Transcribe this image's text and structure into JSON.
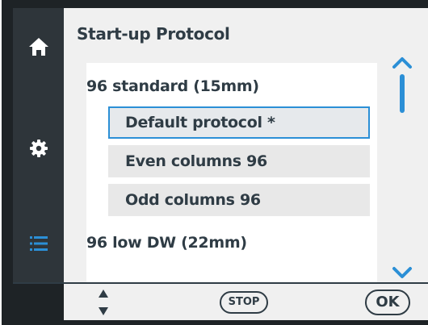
{
  "screen": {
    "title": "Start-up Protocol"
  },
  "nav": {
    "items": [
      {
        "icon": "home-icon"
      },
      {
        "icon": "gear-icon"
      },
      {
        "icon": "list-icon"
      }
    ]
  },
  "protocol_list": {
    "groups": [
      {
        "label": "96 standard (15mm)",
        "items": [
          {
            "label": "Default protocol *",
            "selected": true
          },
          {
            "label": "Even columns 96",
            "selected": false
          },
          {
            "label": "Odd columns 96",
            "selected": false
          }
        ]
      },
      {
        "label": "96 low DW (22mm)",
        "items": []
      }
    ]
  },
  "footer": {
    "stop_label": "STOP",
    "ok_label": "OK"
  },
  "colors": {
    "accent": "#2b8fd6",
    "frame": "#1e2326",
    "rail": "#2e353a",
    "text": "#2f3c45"
  }
}
